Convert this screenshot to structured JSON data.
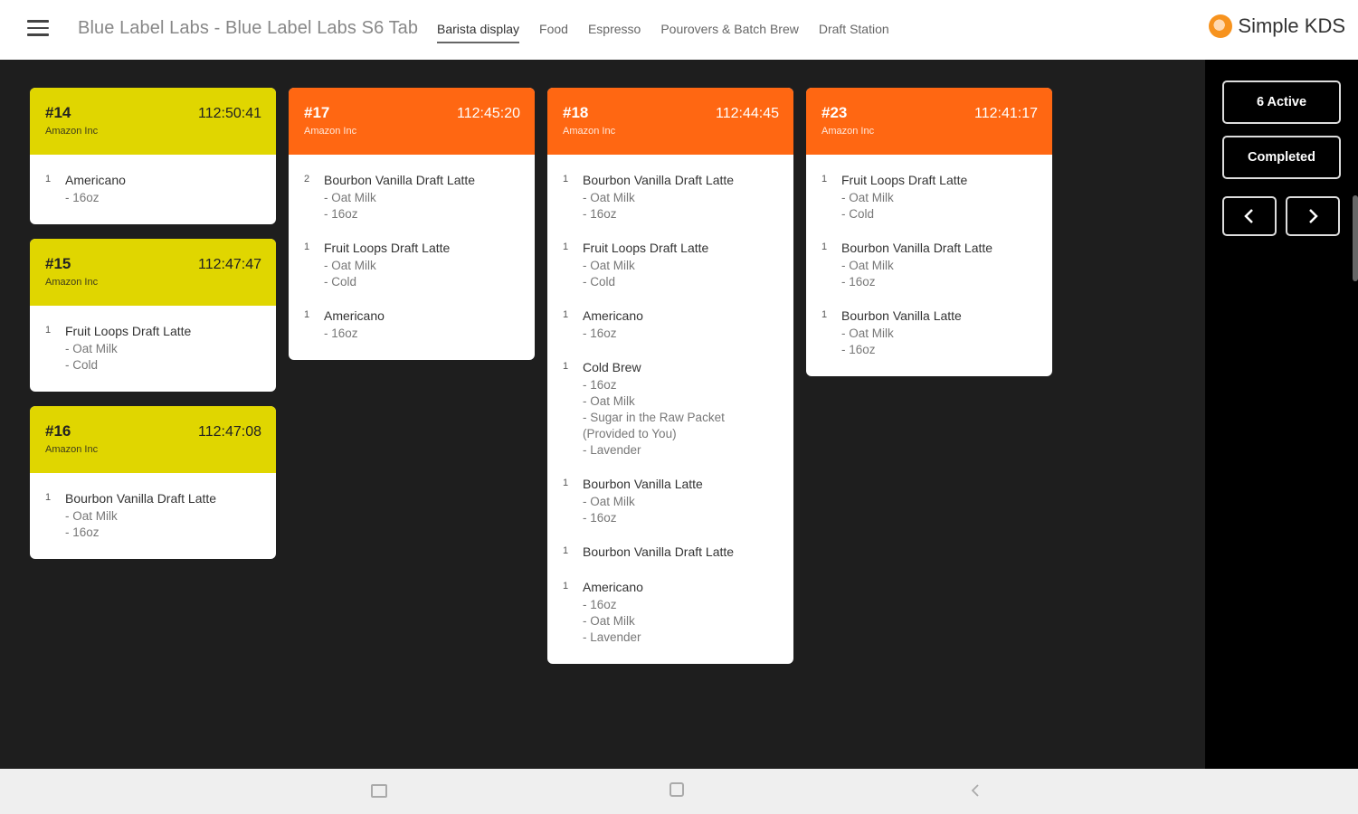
{
  "header": {
    "title": "Blue Label Labs - Blue Label Labs S6 Tab",
    "tabs": [
      "Barista display",
      "Food",
      "Espresso",
      "Pourovers & Batch Brew",
      "Draft Station"
    ],
    "active_tab": "Barista display",
    "brand": "Simple KDS"
  },
  "side": {
    "active_label": "6 Active",
    "completed_label": "Completed",
    "prev_icon": "chevron-left-icon",
    "next_icon": "chevron-right-icon"
  },
  "colors": {
    "yellow": "#e0d600",
    "orange": "#ff6712",
    "board": "#1e1e1e"
  },
  "tickets": {
    "t14": {
      "number": "#14",
      "time": "112:50:41",
      "customer": "Amazon Inc",
      "items": [
        {
          "qty": "1",
          "name": "Americano",
          "mods": [
            "- 16oz"
          ]
        }
      ]
    },
    "t15": {
      "number": "#15",
      "time": "112:47:47",
      "customer": "Amazon Inc",
      "items": [
        {
          "qty": "1",
          "name": "Fruit Loops Draft Latte",
          "mods": [
            "- Oat Milk",
            "- Cold"
          ]
        }
      ]
    },
    "t16": {
      "number": "#16",
      "time": "112:47:08",
      "customer": "Amazon Inc",
      "items": [
        {
          "qty": "1",
          "name": "Bourbon Vanilla Draft Latte",
          "mods": [
            "- Oat Milk",
            "- 16oz"
          ]
        }
      ]
    },
    "t17": {
      "number": "#17",
      "time": "112:45:20",
      "customer": "Amazon Inc",
      "items": [
        {
          "qty": "2",
          "name": "Bourbon Vanilla Draft Latte",
          "mods": [
            "- Oat Milk",
            "- 16oz"
          ]
        },
        {
          "qty": "1",
          "name": "Fruit Loops Draft Latte",
          "mods": [
            "- Oat Milk",
            "- Cold"
          ]
        },
        {
          "qty": "1",
          "name": "Americano",
          "mods": [
            "- 16oz"
          ]
        }
      ]
    },
    "t18": {
      "number": "#18",
      "time": "112:44:45",
      "customer": "Amazon Inc",
      "items": [
        {
          "qty": "1",
          "name": "Bourbon Vanilla Draft Latte",
          "mods": [
            "- Oat Milk",
            "- 16oz"
          ]
        },
        {
          "qty": "1",
          "name": "Fruit Loops Draft Latte",
          "mods": [
            "- Oat Milk",
            "- Cold"
          ]
        },
        {
          "qty": "1",
          "name": "Americano",
          "mods": [
            "- 16oz"
          ]
        },
        {
          "qty": "1",
          "name": "Cold Brew",
          "mods": [
            "- 16oz",
            "- Oat Milk",
            "- Sugar in the Raw Packet",
            "(Provided to You)",
            "- Lavender"
          ]
        },
        {
          "qty": "1",
          "name": "Bourbon Vanilla Latte",
          "mods": [
            "- Oat Milk",
            "- 16oz"
          ]
        },
        {
          "qty": "1",
          "name": "Bourbon Vanilla Draft Latte",
          "mods": []
        },
        {
          "qty": "1",
          "name": "Americano",
          "mods": [
            "- 16oz",
            "- Oat Milk",
            "- Lavender"
          ]
        }
      ]
    },
    "t23": {
      "number": "#23",
      "time": "112:41:17",
      "customer": "Amazon Inc",
      "items": [
        {
          "qty": "1",
          "name": "Fruit Loops Draft Latte",
          "mods": [
            "- Oat Milk",
            "- Cold"
          ]
        },
        {
          "qty": "1",
          "name": "Bourbon Vanilla Draft Latte",
          "mods": [
            "- Oat Milk",
            "- 16oz"
          ]
        },
        {
          "qty": "1",
          "name": "Bourbon Vanilla Latte",
          "mods": [
            "- Oat Milk",
            "- 16oz"
          ]
        }
      ]
    }
  }
}
